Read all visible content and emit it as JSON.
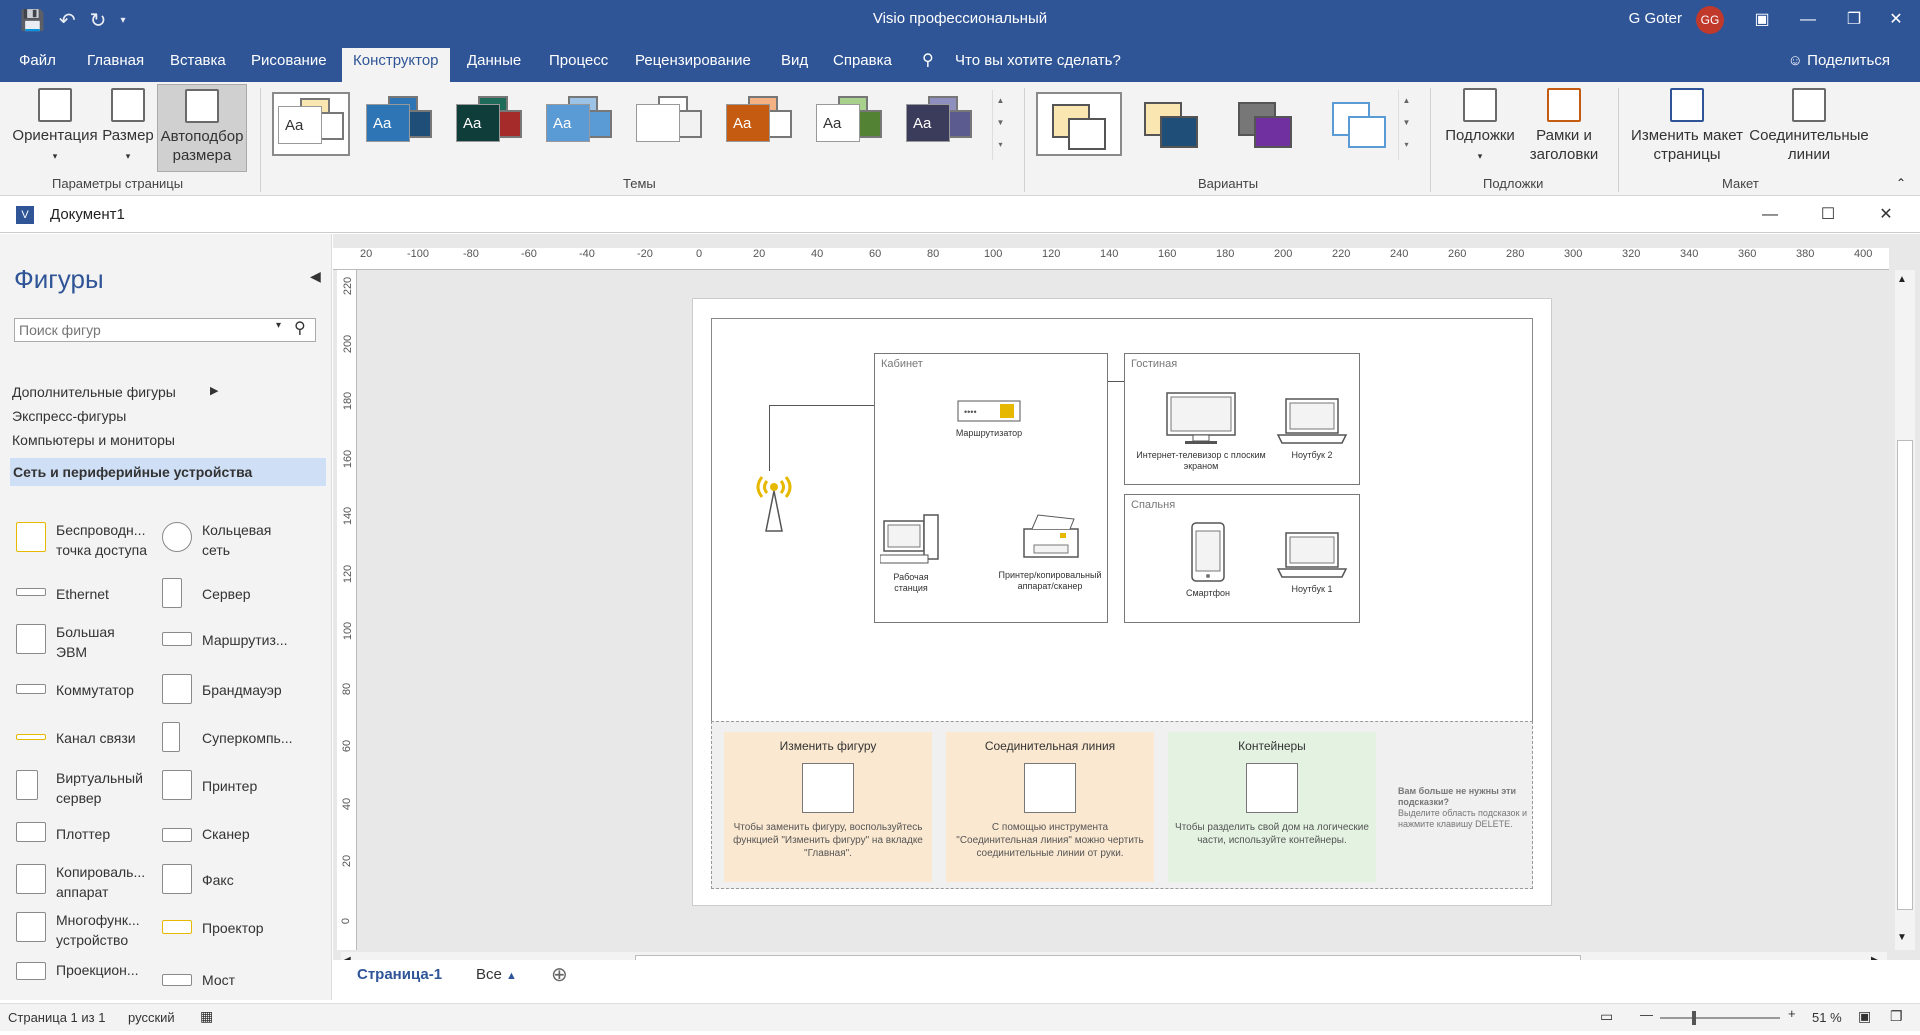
{
  "window": {
    "app_title": "Visio профессиональный",
    "user_name": "G Goter",
    "user_initials": "GG"
  },
  "tabs": [
    {
      "label": "Файл"
    },
    {
      "label": "Главная"
    },
    {
      "label": "Вставка"
    },
    {
      "label": "Рисование"
    },
    {
      "label": "Конструктор"
    },
    {
      "label": "Данные"
    },
    {
      "label": "Процесс"
    },
    {
      "label": "Рецензирование"
    },
    {
      "label": "Вид"
    },
    {
      "label": "Справка"
    }
  ],
  "tell_me": "Что вы хотите сделать?",
  "share_label": "Поделиться",
  "ribbon": {
    "page_setup": {
      "orientation": "Ориентация",
      "size": "Размер",
      "autofit": "Автоподбор размера",
      "group_label": "Параметры страницы"
    },
    "themes": {
      "group_label": "Темы",
      "sample_text": "Aa"
    },
    "variants": {
      "group_label": "Варианты"
    },
    "backgrounds": {
      "backgrounds": "Подложки",
      "borders": "Рамки и заголовки",
      "group_label": "Подложки"
    },
    "layout": {
      "relayout": "Изменить макет страницы",
      "connectors": "Соединительные линии",
      "group_label": "Макет"
    }
  },
  "document": {
    "name": "Документ1"
  },
  "shapes_pane": {
    "title": "Фигуры",
    "search_placeholder": "Поиск фигур",
    "stencils": [
      {
        "label": "Дополнительные фигуры"
      },
      {
        "label": "Экспресс-фигуры"
      },
      {
        "label": "Компьютеры и мониторы"
      },
      {
        "label": "Сеть и периферийные устройства"
      }
    ],
    "shapes": [
      {
        "label": "Беспроводн... точка доступа"
      },
      {
        "label": "Кольцевая сеть"
      },
      {
        "label": "Ethernet"
      },
      {
        "label": "Сервер"
      },
      {
        "label": "Большая ЭВМ"
      },
      {
        "label": "Маршрутиз..."
      },
      {
        "label": "Коммутатор"
      },
      {
        "label": "Брандмауэр"
      },
      {
        "label": "Канал связи"
      },
      {
        "label": "Суперкомпь..."
      },
      {
        "label": "Виртуальный сервер"
      },
      {
        "label": "Принтер"
      },
      {
        "label": "Плоттер"
      },
      {
        "label": "Сканер"
      },
      {
        "label": "Копироваль... аппарат"
      },
      {
        "label": "Факс"
      },
      {
        "label": "Многофунк... устройство"
      },
      {
        "label": "Проектор"
      },
      {
        "label": "Проекцион..."
      },
      {
        "label": "Мост"
      }
    ]
  },
  "ruler": {
    "h_ticks": [
      "20",
      "-100",
      "-80",
      "-60",
      "-40",
      "-20",
      "0",
      "20",
      "40",
      "60",
      "80",
      "100",
      "120",
      "140",
      "160",
      "180",
      "200",
      "220",
      "240",
      "260",
      "280",
      "300",
      "320",
      "340",
      "360",
      "380",
      "400"
    ],
    "v_ticks": [
      "220",
      "200",
      "180",
      "160",
      "140",
      "120",
      "100",
      "80",
      "60",
      "40",
      "20",
      "0"
    ]
  },
  "diagram": {
    "rooms": {
      "office": "Кабинет",
      "living": "Гостиная",
      "bedroom": "Спальня"
    },
    "devices": {
      "router": "Маршрутизатор",
      "workstation": "Рабочая станция",
      "printer": "Принтер/копировальный аппарат/сканер",
      "tv": "Интернет-телевизор с плоским экраном",
      "laptop2": "Ноутбук 2",
      "phone": "Смартфон",
      "laptop1": "Ноутбук 1"
    },
    "hints": [
      {
        "title": "Изменить фигуру",
        "text": "Чтобы заменить фигуру, воспользуйтесь функцией \"Изменить фигуру\" на вкладке \"Главная\".",
        "color": "#fbe8d0"
      },
      {
        "title": "Соединительная линия",
        "text": "С помощью инструмента \"Соединительная линия\" можно чертить соединительные линии от руки.",
        "color": "#fbe8d0"
      },
      {
        "title": "Контейнеры",
        "text": "Чтобы разделить свой дом на логические части, используйте контейнеры.",
        "color": "#e3f2e1"
      }
    ],
    "hint_note_title": "Вам больше не нужны эти подсказки?",
    "hint_note_text": "Выделите область подсказок и нажмите клавишу DELETE."
  },
  "page_tabs": {
    "page1": "Страница-1",
    "all": "Все"
  },
  "status": {
    "page": "Страница 1 из 1",
    "language": "русский",
    "zoom": "51 %"
  },
  "colors": {
    "accent": "#2f5597",
    "wifi": "#e6b800"
  }
}
